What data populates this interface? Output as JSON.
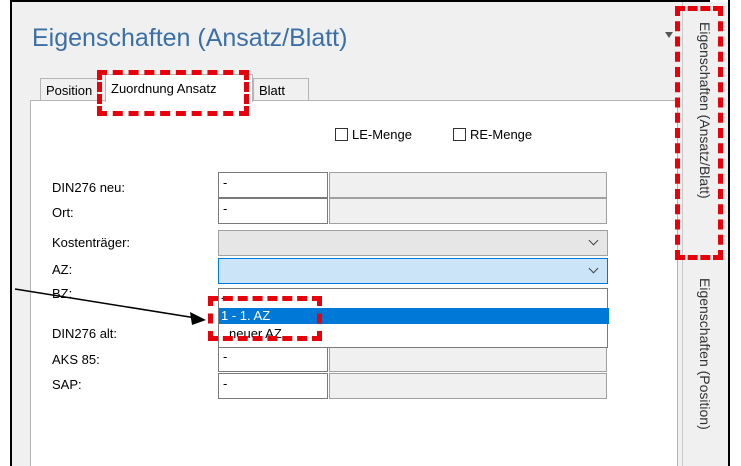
{
  "panel": {
    "title": "Eigenschaften (Ansatz/Blatt)"
  },
  "tabs": [
    {
      "label": "Position",
      "active": false
    },
    {
      "label": "Zuordnung Ansatz",
      "active": true
    },
    {
      "label": "Blatt",
      "active": false
    }
  ],
  "checkboxes": [
    {
      "label": "LE-Menge",
      "checked": false
    },
    {
      "label": "RE-Menge",
      "checked": false
    }
  ],
  "fields": [
    {
      "label": "DIN276 neu:",
      "value": "-"
    },
    {
      "label": "Ort:",
      "value": "-"
    },
    {
      "label": "Kostenträger:",
      "value": ""
    },
    {
      "label": "AZ:",
      "value": ""
    },
    {
      "label": "BZ:",
      "value": ""
    },
    {
      "label": "DIN276 alt:",
      "value": ""
    },
    {
      "label": "AKS 85:",
      "value": "-"
    },
    {
      "label": "SAP:",
      "value": "-"
    }
  ],
  "dropdown": {
    "options": [
      "-",
      "1 - 1. AZ",
      "neuer AZ"
    ],
    "selected_index": 1
  },
  "side_tabs": [
    "Eigenschaften (Ansatz/Blatt)",
    "Eigenschaften (Position)"
  ],
  "colors": {
    "title": "#3b6fa8",
    "selection": "#0078d7",
    "annotation": "#e8000b",
    "combo_focus": "#cce4f7"
  }
}
